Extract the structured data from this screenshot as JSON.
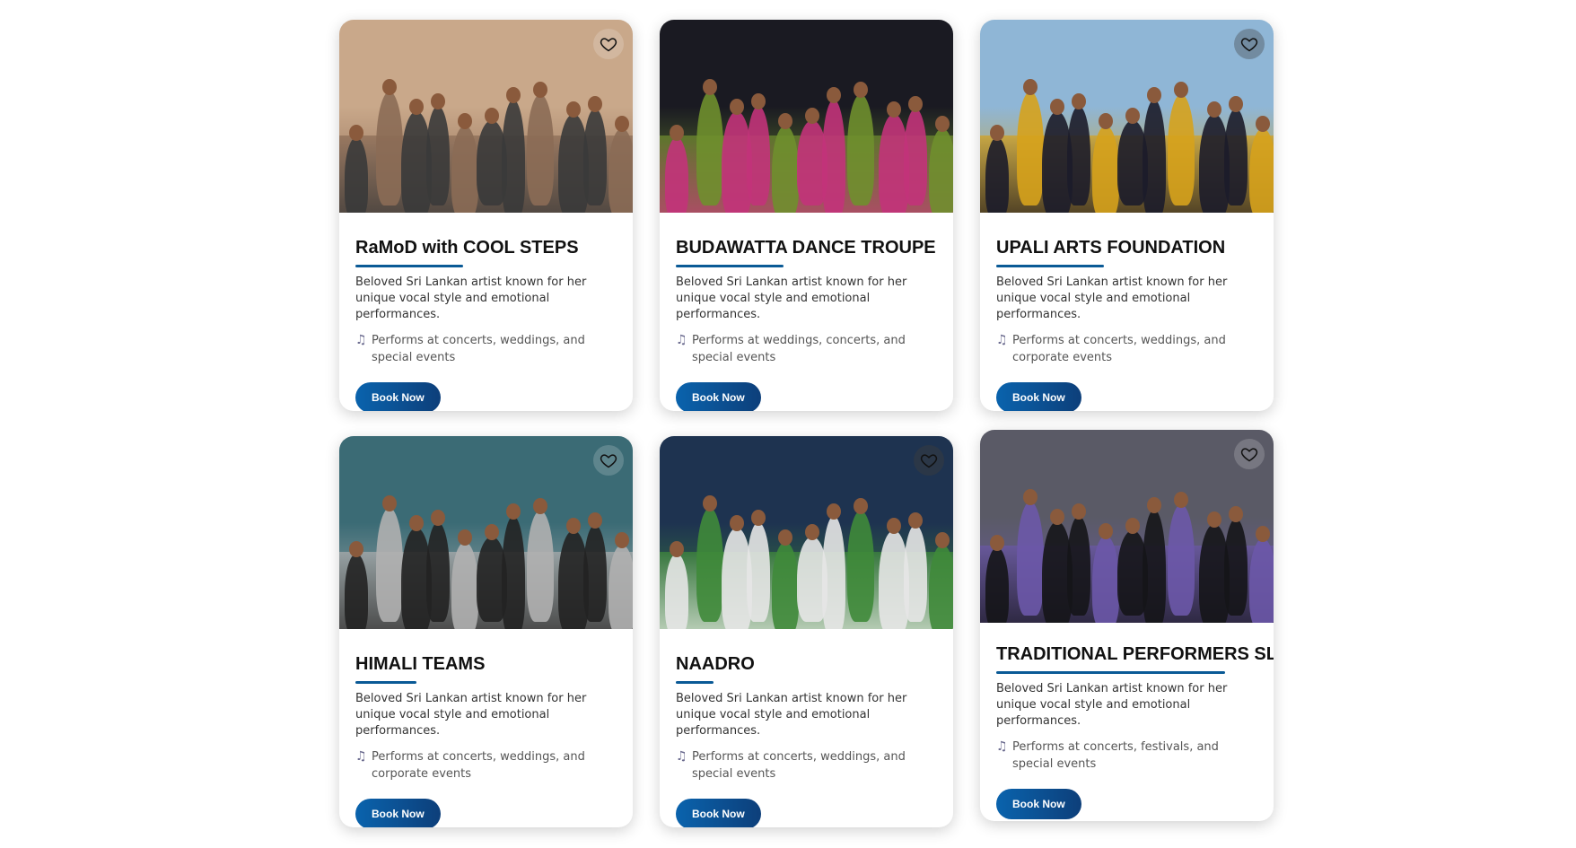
{
  "cards": [
    {
      "title": "RaMoD with COOL STEPS",
      "description": "Beloved Sri Lankan artist known for her unique vocal style and emotional performances.",
      "performs": "Performs at concerts, weddings, and special events",
      "button": "Book Now",
      "icon": "heart-icon",
      "photo_colors": [
        "#c9a88a",
        "#3a3a3a",
        "#8b6b55"
      ]
    },
    {
      "title": "BUDAWATTA DANCE TROUPE",
      "description": "Beloved Sri Lankan artist known for her unique vocal style and emotional performances.",
      "performs": "Performs at weddings, concerts, and special events",
      "button": "Book Now",
      "icon": "heart-icon",
      "photo_colors": [
        "#1a1a22",
        "#c2337a",
        "#6f8f2e"
      ]
    },
    {
      "title": "UPALI ARTS FOUNDATION",
      "description": "Beloved Sri Lankan artist known for her unique vocal style and emotional performances.",
      "performs": "Performs at concerts, weddings, and corporate events",
      "button": "Book Now",
      "icon": "heart-icon",
      "photo_colors": [
        "#8fb6d6",
        "#1c1c2a",
        "#d6a21c"
      ]
    },
    {
      "title": "HIMALI TEAMS",
      "description": "Beloved Sri Lankan artist known for her unique vocal style and emotional performances.",
      "performs": "Performs at concerts, weddings, and corporate events",
      "button": "Book Now",
      "icon": "heart-icon",
      "photo_colors": [
        "#3b6b75",
        "#222222",
        "#b0b0b0"
      ]
    },
    {
      "title": "NAADRO",
      "description": "Beloved Sri Lankan artist known for her unique vocal style and emotional performances.",
      "performs": "Performs at concerts, weddings, and special events",
      "button": "Book Now",
      "icon": "heart-icon",
      "photo_colors": [
        "#1e3350",
        "#e6e6e6",
        "#3f8a3a"
      ]
    },
    {
      "title": "TRADITIONAL PERFORMERS SL",
      "description": "Beloved Sri Lankan artist known for her unique vocal style and emotional performances.",
      "performs": "Performs at concerts, festivals, and special events",
      "button": "Book Now",
      "icon": "heart-icon",
      "photo_colors": [
        "#5a5a66",
        "#151518",
        "#6b58a8"
      ]
    }
  ],
  "colors": {
    "accent": "#0a5a96",
    "button_start": "#0a63ad",
    "button_end": "#0d3f7a",
    "title": "#111111"
  }
}
